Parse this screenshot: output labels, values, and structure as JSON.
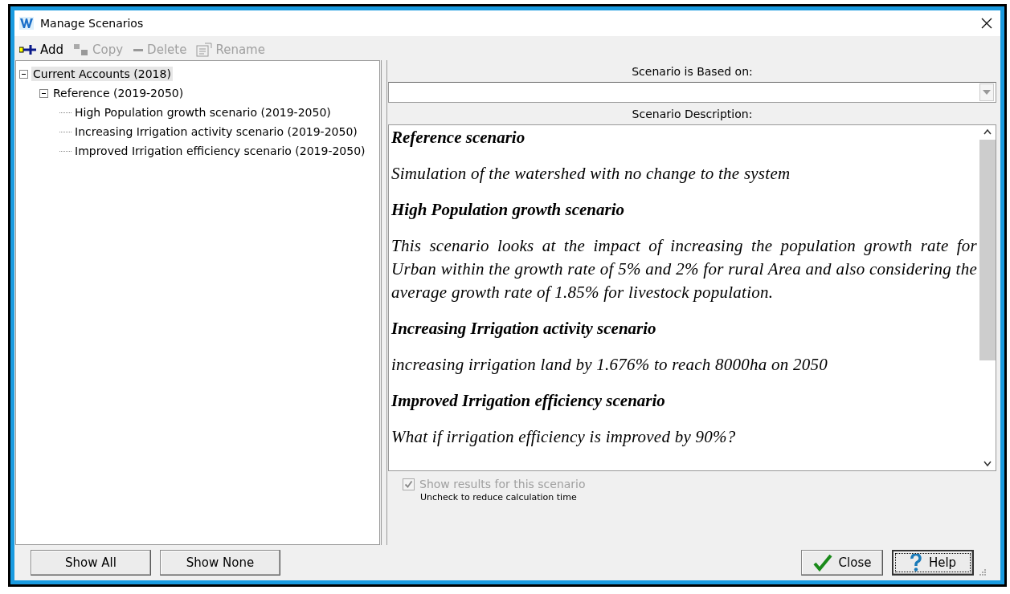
{
  "window": {
    "title": "Manage Scenarios"
  },
  "toolbar": [
    {
      "label": "Add",
      "kind": "add",
      "disabled": false
    },
    {
      "label": "Copy",
      "kind": "copy",
      "disabled": true
    },
    {
      "label": "Delete",
      "kind": "delete",
      "disabled": true
    },
    {
      "label": "Rename",
      "kind": "rename",
      "disabled": true
    }
  ],
  "tree": [
    {
      "label": "Current Accounts (2018)",
      "selected": true,
      "expanded": true,
      "children": [
        {
          "label": "Reference (2019-2050)",
          "selected": false,
          "expanded": true,
          "children": [
            {
              "label": "High Population growth scenario (2019-2050)",
              "selected": false
            },
            {
              "label": "Increasing Irrigation activity scenario (2019-2050)",
              "selected": false
            },
            {
              "label": "Improved Irrigation efficiency scenario (2019-2050)",
              "selected": false
            }
          ]
        }
      ]
    }
  ],
  "based_on": {
    "label": "Scenario is Based on:"
  },
  "description": {
    "label": "Scenario Description:",
    "paragraphs": [
      {
        "kind": "heading",
        "text": "Reference scenario"
      },
      {
        "kind": "body",
        "text": "Simulation of the watershed with no change to the system"
      },
      {
        "kind": "heading",
        "text": "High Population growth scenario"
      },
      {
        "kind": "body",
        "text": "This scenario looks at the impact of increasing the population growth rate for Urban within the growth rate of 5% and 2% for rural Area and also considering the average growth rate of 1.85% for livestock population."
      },
      {
        "kind": "heading",
        "text": "Increasing Irrigation activity scenario"
      },
      {
        "kind": "body",
        "text": "increasing irrigation land by 1.676% to reach 8000ha on 2050"
      },
      {
        "kind": "heading",
        "text": "Improved Irrigation efficiency scenario"
      },
      {
        "kind": "body",
        "text": "What if irrigation efficiency is improved by 90%?"
      }
    ]
  },
  "show_results": {
    "label": "Show results for this scenario",
    "checked": true,
    "disabled": true,
    "hint": "Uncheck to reduce calculation time"
  },
  "left_buttons": [
    "Show All",
    "Show None"
  ],
  "right_buttons": [
    {
      "label": "Close",
      "kind": "close"
    },
    {
      "label": "Help",
      "kind": "help"
    }
  ]
}
